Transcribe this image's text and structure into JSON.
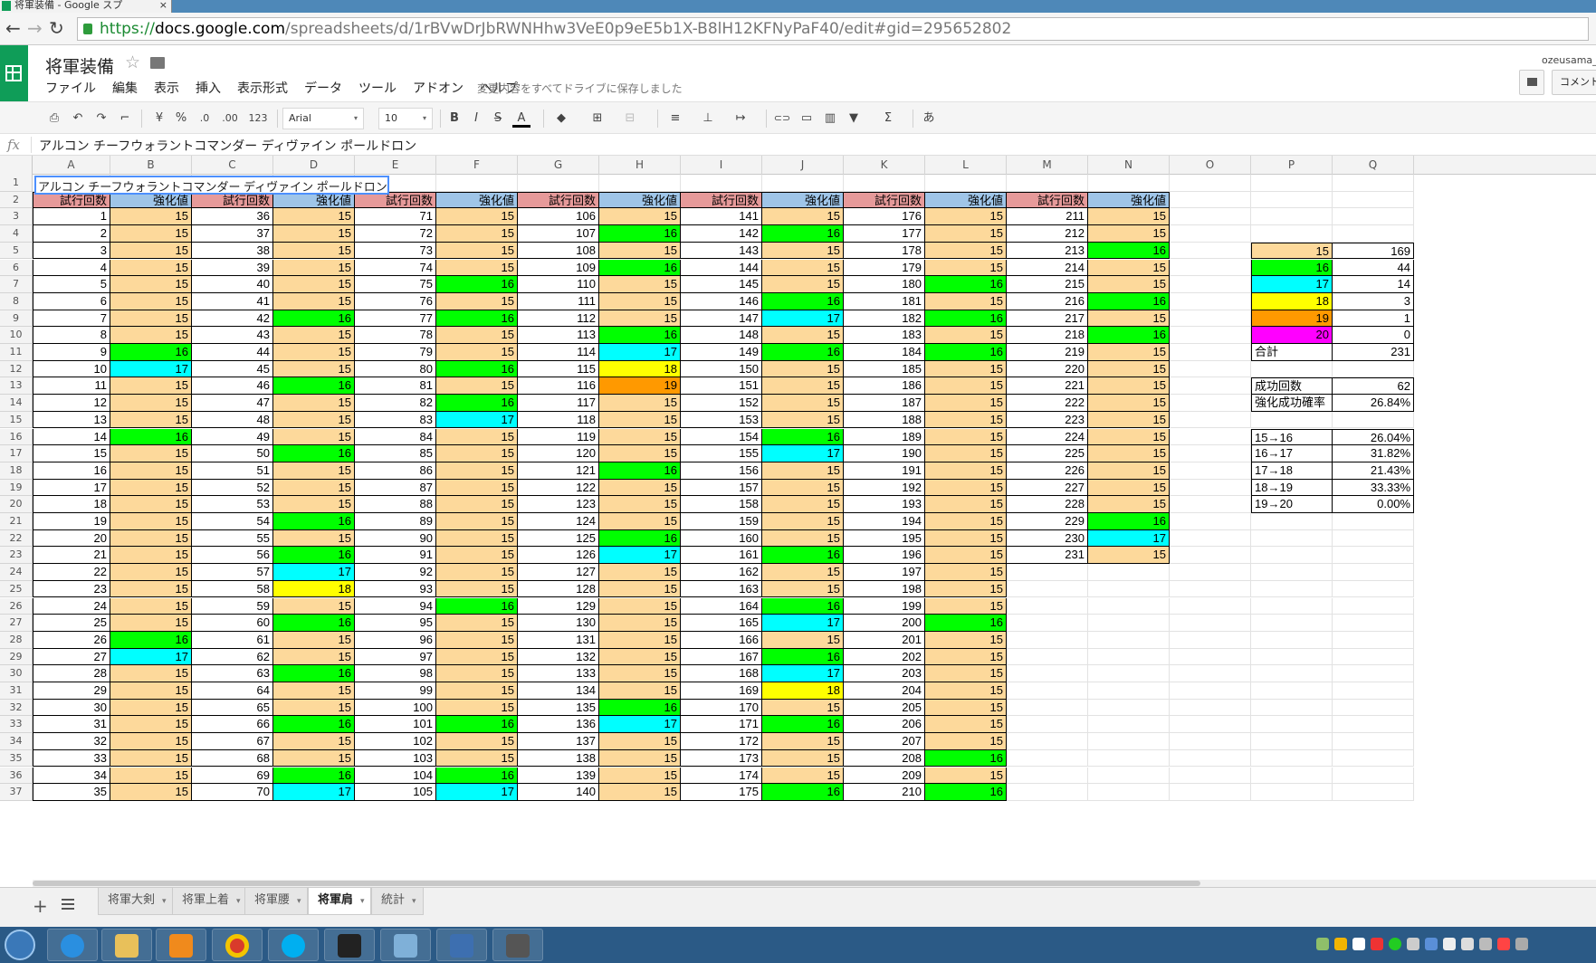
{
  "browser": {
    "tab_title": "将軍装備 - Google スプ",
    "tab_close": "×",
    "back": "←",
    "forward": "→",
    "reload": "↻",
    "url_scheme": "https://",
    "url_host": "docs.google.com",
    "url_rest": "/spreadsheets/d/1rBVwDrJbRWNHhw3VeE0p9eE5b1X-B8lH12KFNyPaF40/edit#gid=295652802"
  },
  "app": {
    "title": "将軍装備",
    "star": "☆",
    "menu": [
      "ファイル",
      "編集",
      "表示",
      "挿入",
      "表示形式",
      "データ",
      "ツール",
      "アドオン",
      "ヘルプ"
    ],
    "save_status": "変更内容をすべてドライブに保存しました",
    "user": "ozeusama_",
    "comments_label": "コメント"
  },
  "toolbar": {
    "print": "⎙",
    "undo": "↶",
    "redo": "↷",
    "paint_format": "⌐",
    "currency": "¥",
    "percent": "%",
    "dec_decrease": ".0",
    "dec_increase": ".00",
    "more_formats": "123",
    "font": "Arial",
    "font_size": "10",
    "bold": "B",
    "italic": "I",
    "strike": "S",
    "text_color": "A",
    "fill": "◆",
    "borders": "⊞",
    "merge": "⊟",
    "halign": "≡",
    "valign": "⊥",
    "wrap": "↦",
    "link": "⊂⊃",
    "comment": "▭",
    "chart": "▥",
    "filter": "▼",
    "functions": "Σ",
    "input_tools": "あ",
    "caret": "▾"
  },
  "formula_bar": {
    "fx": "fx",
    "content": "アルコン チーフウォラントコマンダー ディヴァイン ポールドロン"
  },
  "grid": {
    "columns": [
      "A",
      "B",
      "C",
      "D",
      "E",
      "F",
      "G",
      "H",
      "I",
      "J",
      "K",
      "L",
      "M",
      "N",
      "O",
      "P",
      "Q"
    ],
    "rows": [
      "1",
      "2",
      "3",
      "4",
      "5",
      "6",
      "7",
      "8",
      "9",
      "10",
      "11",
      "12",
      "13",
      "14",
      "15",
      "16",
      "17",
      "18",
      "19",
      "20",
      "21",
      "22",
      "23",
      "24",
      "25",
      "26",
      "27",
      "28",
      "29",
      "30",
      "31",
      "32",
      "33",
      "34",
      "35",
      "36",
      "37"
    ],
    "a1": "アルコン チーフウォラントコマンダー ディヴァイン ポールドロン",
    "header_trial": "試行回数",
    "header_value": "強化値",
    "enhance_values": [
      "15",
      "15",
      "15",
      "15",
      "15",
      "15",
      "15",
      "15",
      "16",
      "17",
      "15",
      "15",
      "15",
      "16",
      "15",
      "15",
      "15",
      "15",
      "15",
      "15",
      "15",
      "15",
      "15",
      "15",
      "15",
      "16",
      "17",
      "15",
      "15",
      "15",
      "15",
      "15",
      "15",
      "15",
      "15",
      "15",
      "15",
      "15",
      "15",
      "15",
      "15",
      "16",
      "15",
      "15",
      "15",
      "16",
      "15",
      "15",
      "15",
      "16",
      "15",
      "15",
      "15",
      "16",
      "15",
      "16",
      "17",
      "18",
      "15",
      "16",
      "15",
      "15",
      "16",
      "15",
      "15",
      "16",
      "15",
      "15",
      "16",
      "17",
      "15",
      "15",
      "15",
      "15",
      "16",
      "15",
      "16",
      "15",
      "15",
      "16",
      "15",
      "16",
      "17",
      "15",
      "15",
      "15",
      "15",
      "15",
      "15",
      "15",
      "15",
      "15",
      "15",
      "16",
      "15",
      "15",
      "15",
      "15",
      "15",
      "15",
      "16",
      "15",
      "15",
      "16",
      "17",
      "15",
      "16",
      "15",
      "16",
      "15",
      "15",
      "15",
      "16",
      "17",
      "18",
      "19",
      "15",
      "15",
      "15",
      "15",
      "16",
      "15",
      "15",
      "15",
      "16",
      "17",
      "15",
      "15",
      "15",
      "15",
      "15",
      "15",
      "15",
      "15",
      "16",
      "17",
      "15",
      "15",
      "15",
      "15",
      "15",
      "16",
      "15",
      "15",
      "15",
      "16",
      "17",
      "15",
      "16",
      "15",
      "15",
      "15",
      "15",
      "16",
      "17",
      "15",
      "15",
      "15",
      "15",
      "15",
      "16",
      "15",
      "15",
      "16",
      "17",
      "15",
      "16",
      "17",
      "18",
      "15",
      "16",
      "15",
      "15",
      "15",
      "16",
      "15",
      "15",
      "15",
      "15",
      "16",
      "15",
      "16",
      "15",
      "16",
      "15",
      "15",
      "15",
      "15",
      "15",
      "15",
      "15",
      "15",
      "15",
      "15",
      "15",
      "15",
      "15",
      "15",
      "15",
      "16",
      "15",
      "15",
      "15",
      "15",
      "15",
      "15",
      "15",
      "16",
      "15",
      "16",
      "15",
      "15",
      "16",
      "15",
      "15",
      "16",
      "15",
      "16",
      "15",
      "15",
      "15",
      "15",
      "15",
      "15",
      "15",
      "15",
      "15",
      "15",
      "16",
      "17",
      "15"
    ]
  },
  "summary": {
    "legend_values": [
      "15",
      "16",
      "17",
      "18",
      "19",
      "20"
    ],
    "legend_counts": [
      "169",
      "44",
      "14",
      "3",
      "1",
      "0"
    ],
    "total_label": "合計",
    "total_value": "231",
    "success_label": "成功回数",
    "success_value": "62",
    "rate_label": "強化成功確率",
    "rate_value": "26.84%",
    "transitions": [
      {
        "label": "15→16",
        "rate": "26.04%"
      },
      {
        "label": "16→17",
        "rate": "31.82%"
      },
      {
        "label": "17→18",
        "rate": "21.43%"
      },
      {
        "label": "18→19",
        "rate": "33.33%"
      },
      {
        "label": "19→20",
        "rate": "0.00%"
      }
    ]
  },
  "colors": {
    "trial_header": "#e69a9a",
    "value_header": "#9fc5e8",
    "v15": "#fdd99b",
    "v16": "#00ff00",
    "v17": "#00ffff",
    "v18": "#ffff00",
    "v19": "#ff9900",
    "v20": "#ff00ff"
  },
  "sheet_tabs": [
    "将軍大剣",
    "将軍上着",
    "将軍腰",
    "将軍肩",
    "統計"
  ],
  "active_sheet": "将軍肩"
}
